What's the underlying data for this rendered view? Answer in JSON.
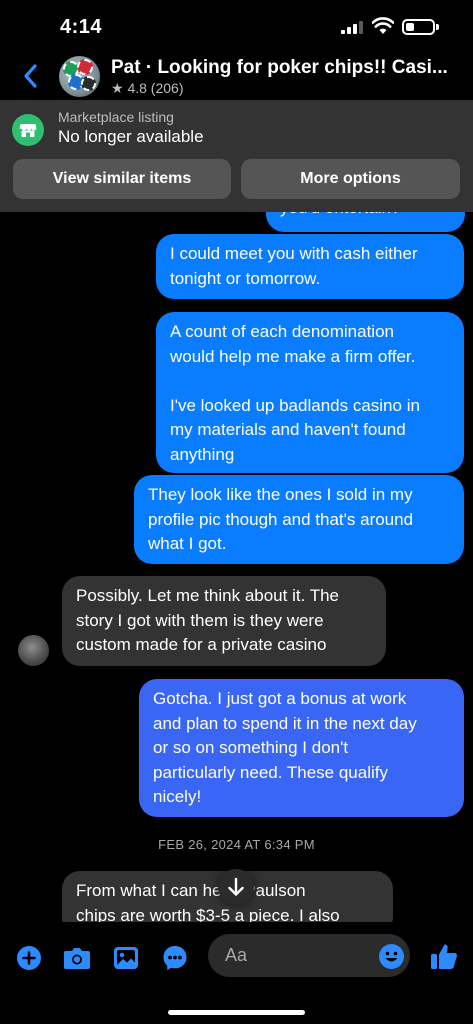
{
  "status_bar": {
    "time": "4:14"
  },
  "header": {
    "title": "Pat · Looking for poker chips!! Casi...",
    "rating": "★ 4.8 (206)"
  },
  "marketplace": {
    "label": "Marketplace listing",
    "status": "No longer available",
    "view_similar": "View similar items",
    "more_options": "More options"
  },
  "messages": [
    {
      "side": "out",
      "text": "you'd entertain?"
    },
    {
      "side": "out",
      "text": "I could meet you with cash either\ntonight or tomorrow."
    },
    {
      "side": "out",
      "text": "A count of each denomination\nwould help me make a firm offer.\n\nI've looked up badlands casino in\nmy materials and haven't found\nanything"
    },
    {
      "side": "out",
      "text": "They look like the ones I sold in my\nprofile pic though and that's around\nwhat I got."
    },
    {
      "side": "in",
      "text": "Possibly. Let me think about it. The\nstory I got with them is they were\ncustom made for a private casino"
    },
    {
      "side": "out",
      "text": "Gotcha.  I just got a bonus at work\nand plan to spend it in the next day\nor so on something I don't\nparticularly need. These qualify\nnicely!"
    },
    {
      "side": "in",
      "text": "From what I can   hese Paulson\nchips are worth $3-5 a piece. I also"
    }
  ],
  "date_separator": "FEB 26, 2024 AT 6:34 PM",
  "composer": {
    "placeholder": "Aa"
  },
  "colors": {
    "accent": "#0a7cff",
    "outgoing": "#0a7cff",
    "incoming": "#333333",
    "market_green": "#2fbf71"
  }
}
